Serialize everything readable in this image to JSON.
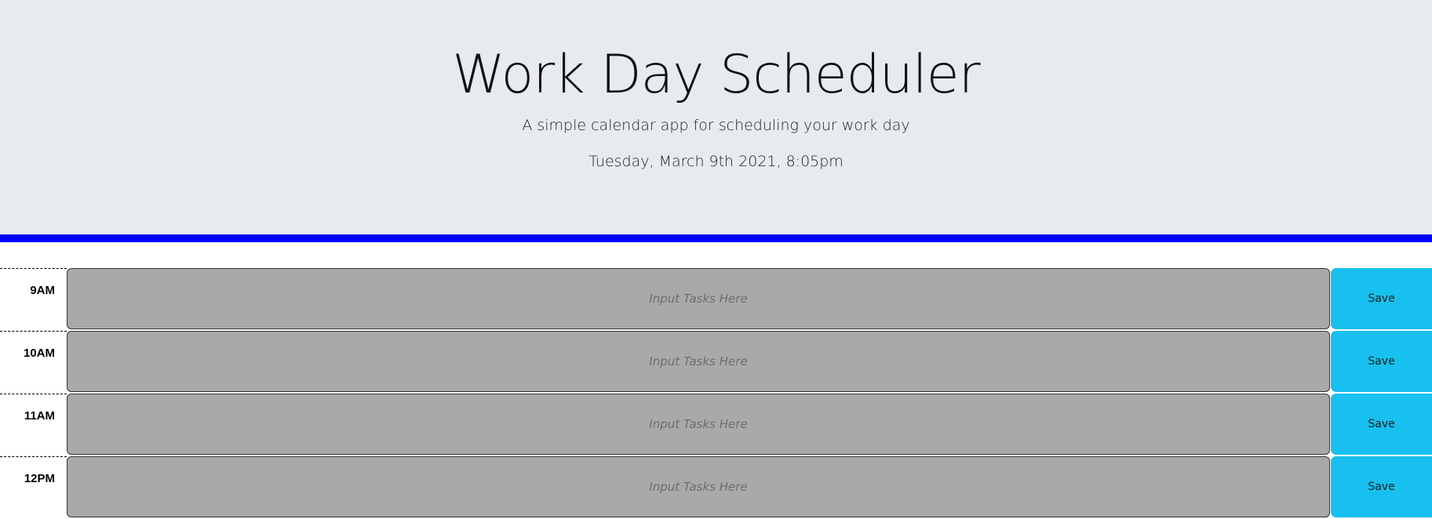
{
  "header": {
    "title": "Work Day Scheduler",
    "subtitle": "A simple calendar app for scheduling your work day",
    "current_day": "Tuesday, March 9th 2021, 8:05pm"
  },
  "time_blocks": [
    {
      "hour": "9AM",
      "placeholder": "Input Tasks Here",
      "save_label": "Save"
    },
    {
      "hour": "10AM",
      "placeholder": "Input Tasks Here",
      "save_label": "Save"
    },
    {
      "hour": "11AM",
      "placeholder": "Input Tasks Here",
      "save_label": "Save"
    },
    {
      "hour": "12PM",
      "placeholder": "Input Tasks Here",
      "save_label": "Save"
    }
  ],
  "colors": {
    "jumbotron_bg": "#e7ebef",
    "divider": "#0000ff",
    "past_block": "#a9a9a9",
    "save_button": "#17c0ee"
  }
}
